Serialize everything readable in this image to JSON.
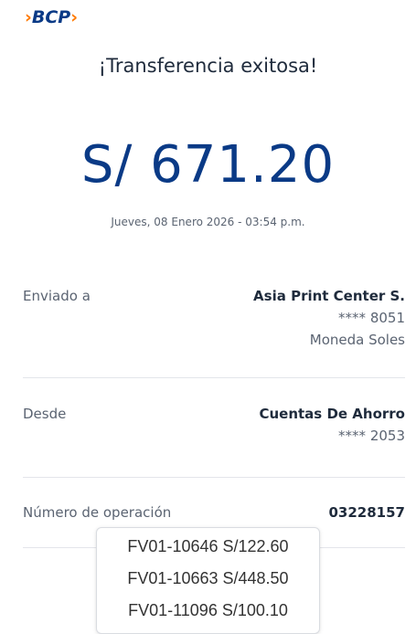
{
  "brand": {
    "logo_text": "BCP",
    "logo_prefix": "›",
    "logo_suffix": "›"
  },
  "status_title": "¡Transferencia exitosa!",
  "amount": "S/ 671.20",
  "datetime": "Jueves, 08 Enero 2026 - 03:54 p.m.",
  "sent_to": {
    "label": "Enviado a",
    "name": "Asia Print Center S.",
    "account": "**** 8051",
    "currency": "Moneda Soles"
  },
  "from": {
    "label": "Desde",
    "account_type": "Cuentas De Ahorro",
    "account": "**** 2053"
  },
  "operation": {
    "label": "Número de operación",
    "number": "03228157"
  },
  "invoices": [
    "FV01-10646 S/122.60",
    "FV01-10663  S/448.50",
    "FV01-11096  S/100.10"
  ]
}
